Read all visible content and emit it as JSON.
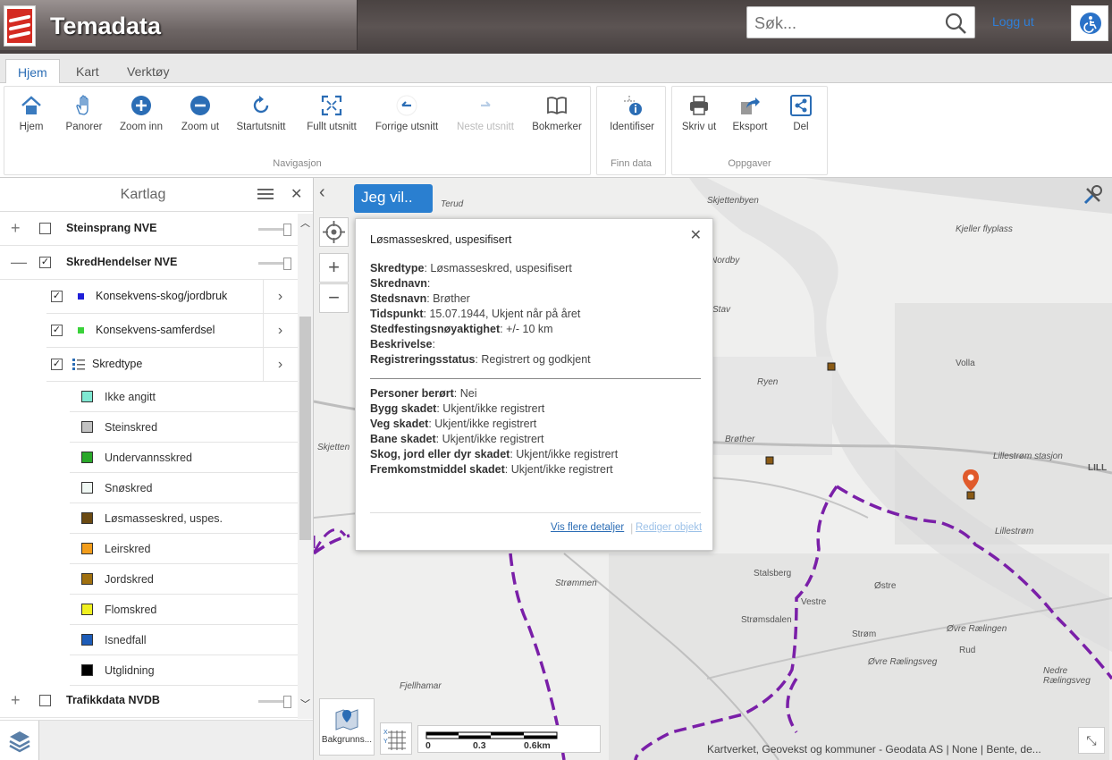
{
  "header": {
    "title": "Temadata",
    "search_placeholder": "Søk...",
    "logout": "Logg ut"
  },
  "tabs": [
    {
      "label": "Hjem",
      "active": true
    },
    {
      "label": "Kart"
    },
    {
      "label": "Verktøy"
    }
  ],
  "ribbon": {
    "navigation": {
      "label": "Navigasjon",
      "buttons": [
        {
          "label": "Hjem",
          "icon": "home-icon"
        },
        {
          "label": "Panorer",
          "icon": "hand-icon"
        },
        {
          "label": "Zoom inn",
          "icon": "zoom-in-icon"
        },
        {
          "label": "Zoom ut",
          "icon": "zoom-out-icon"
        },
        {
          "label": "Startutsnitt",
          "icon": "refresh-icon"
        },
        {
          "label": "Fullt utsnitt",
          "icon": "full-extent-icon"
        },
        {
          "label": "Forrige utsnitt",
          "icon": "back-icon"
        },
        {
          "label": "Neste utsnitt",
          "icon": "forward-icon",
          "disabled": true
        },
        {
          "label": "Bokmerker",
          "icon": "book-icon"
        }
      ]
    },
    "find": {
      "label": "Finn data",
      "buttons": [
        {
          "label": "Identifiser",
          "icon": "identify-icon"
        }
      ]
    },
    "tasks": {
      "label": "Oppgaver",
      "buttons": [
        {
          "label": "Skriv ut",
          "icon": "printer-icon"
        },
        {
          "label": "Eksport",
          "icon": "export-icon"
        },
        {
          "label": "Del",
          "icon": "share-icon"
        }
      ]
    }
  },
  "kartlag": {
    "title": "Kartlag",
    "layers": [
      {
        "label": "Steinsprang NVE",
        "checked": false
      },
      {
        "label": "SkredHendelser NVE",
        "checked": true
      },
      {
        "label": "Konsekvens-skog/jordbruk",
        "checked": true,
        "color": "#1f1fd8"
      },
      {
        "label": "Konsekvens-samferdsel",
        "checked": true,
        "color": "#3ad23a"
      },
      {
        "label": "Skredtype",
        "checked": true
      },
      {
        "label": "Trafikkdata NVDB",
        "checked": false
      }
    ],
    "legend": [
      {
        "label": "Ikke angitt",
        "color": "#7fe8d2"
      },
      {
        "label": "Steinskred",
        "color": "#c2c2c2"
      },
      {
        "label": "Undervannsskred",
        "color": "#2aa82a"
      },
      {
        "label": "Snøskred",
        "color": "#f0f8f4"
      },
      {
        "label": "Løsmasseskred, uspes.",
        "color": "#6b4a12"
      },
      {
        "label": "Leirskred",
        "color": "#f29d1b"
      },
      {
        "label": "Jordskred",
        "color": "#a0700f"
      },
      {
        "label": "Flomskred",
        "color": "#f0f020"
      },
      {
        "label": "Isnedfall",
        "color": "#1d5cb8"
      },
      {
        "label": "Utglidning",
        "color": "#000000"
      }
    ]
  },
  "map": {
    "jeg_vil": "Jeg vil..",
    "popup": {
      "title": "Løsmasseskred, uspesifisert",
      "fields1": [
        {
          "k": "Skredtype",
          "v": "Løsmasseskred, uspesifisert"
        },
        {
          "k": "Skrednavn",
          "v": ""
        },
        {
          "k": "Stedsnavn",
          "v": "Brøther"
        },
        {
          "k": "Tidspunkt",
          "v": "15.07.1944, Ukjent når på året"
        },
        {
          "k": "Stedfestingsnøyaktighet",
          "v": "+/- 10 km"
        },
        {
          "k": "Beskrivelse",
          "v": ""
        },
        {
          "k": "Registreringsstatus",
          "v": "Registrert og godkjent"
        }
      ],
      "fields2": [
        {
          "k": "Personer berørt",
          "v": "Nei"
        },
        {
          "k": "Bygg skadet",
          "v": "Ukjent/ikke registrert"
        },
        {
          "k": "Veg skadet",
          "v": "Ukjent/ikke registrert"
        },
        {
          "k": "Bane skadet",
          "v": "Ukjent/ikke registrert"
        },
        {
          "k": "Skog, jord eller dyr skadet",
          "v": "Ukjent/ikke registrert"
        },
        {
          "k": "Fremkomstmiddel skadet",
          "v": "Ukjent/ikke registrert"
        }
      ],
      "details_link": "Vis flere detaljer",
      "edit_link": "Rediger objekt"
    },
    "basemap_label": "Bakgrunns...",
    "scale": {
      "ticks": [
        "0",
        "0.3",
        "0.6km"
      ]
    },
    "attribution": "Kartverket, Geovekst og kommuner - Geodata AS | None | Bente, de...",
    "place_labels": [
      "Terud",
      "Skjetten",
      "Kjeller flyplass",
      "Nordby",
      "Stav",
      "Volla",
      "Ryen",
      "Skjettenbyen",
      "Brøther",
      "Lillestrøm",
      "Strømmen",
      "Stalsberg",
      "Vestre",
      "Strøm",
      "Østre",
      "Øvre Rælingen",
      "Rud",
      "Strømsdalen",
      "Øvre Rælingsveg",
      "Nedre Rælingsveg",
      "Fjellhamar",
      "Lillestrøm stasjon",
      "LILL"
    ]
  },
  "colors": {
    "accent": "#2a7fd0",
    "route": "#7a1fa8",
    "marker": "#e05a2b"
  }
}
